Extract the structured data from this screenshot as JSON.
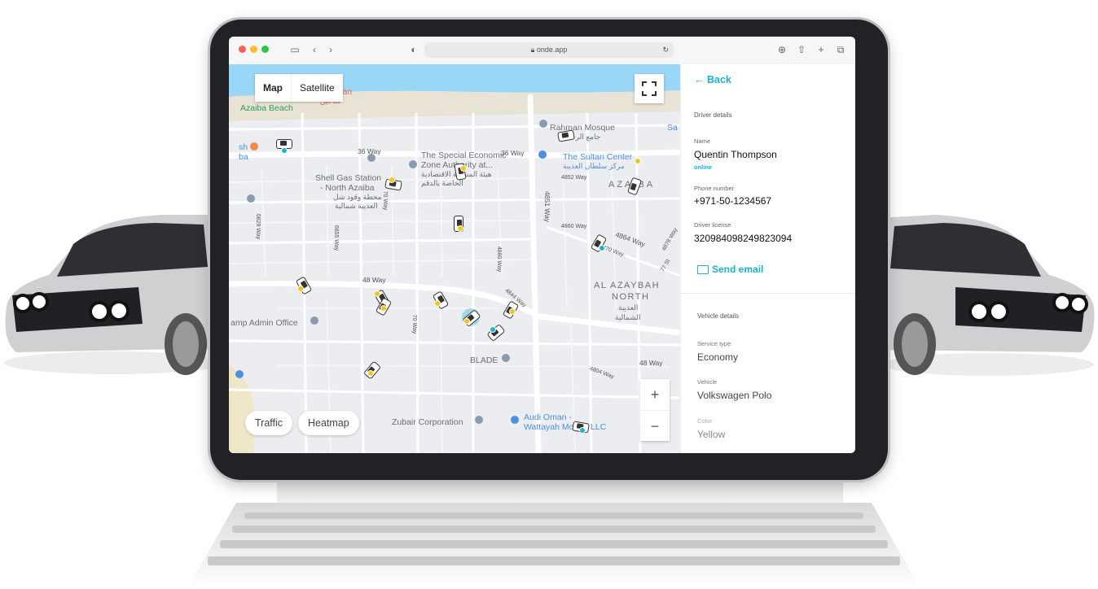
{
  "browser": {
    "url": "onde.app"
  },
  "map": {
    "map_tab": "Map",
    "satellite_tab": "Satellite",
    "traffic_button": "Traffic",
    "heatmap_button": "Heatmap",
    "zoom_in": "+",
    "zoom_out": "−",
    "labels": {
      "majeen": "najeen Oman",
      "majeen_ar": "ڤناخين",
      "azaiba_beach": "Azaiba Beach",
      "way36_a": "36 Way",
      "way36_b": "36 Way",
      "rahman": "Rahman Mosque",
      "rahman_ar": "جامع الرحمن",
      "sa": "Sa",
      "sh": "sh",
      "ba": "ba",
      "special1": "The Special Economic",
      "special2": "Zone Authority at...",
      "special_ar1": "هيئة المنطقة الاقتصادية",
      "special_ar2": "الخاصة بالدقم",
      "sultan": "The Sultan Center",
      "sultan_ar": "مركز سلطان العذيبة",
      "shell1": "Shell Gas Station",
      "shell2": "- North Azaiba",
      "shell_ar1": "محطة وقود شل",
      "shell_ar2": "العذيبة شمالية",
      "azaiba": "AZAIBA",
      "al_azaybah1": "AL AZAYBAH",
      "al_azaybah2": "NORTH",
      "al_azaybah_ar1": "العذيبة",
      "al_azaybah_ar2": "الشمالية",
      "way48_a": "48 Way",
      "way48_b": "48 Way",
      "camp": "amp Admin Office",
      "blade": "BLADE",
      "zubair": "Zubair Corporation",
      "audi1": "Audi Oman -",
      "audi2": "Wattayah Motors LLC",
      "w4852": "4852 Way",
      "w4851": "4851 Way",
      "w4860": "4860 Way",
      "w4864": "4864 Way",
      "w4870": "4870 Way",
      "w4878": "4878 Way",
      "w77st": "77 St",
      "w6829": "6829 Way",
      "w6855": "6855 Way",
      "w70a": "70 Way",
      "w70b": "70 Way",
      "w4844": "4844 Way",
      "w4804": "4804 Way",
      "w4880": "4880 Way"
    }
  },
  "panel": {
    "back_label": "Back",
    "driver_section": "Driver details",
    "name_label": "Name",
    "name_value": "Quentin Thompson",
    "status": "online",
    "phone_label": "Phone number",
    "phone_value": "+971-50-1234567",
    "license_label": "Driver license",
    "license_value": "320984098249823094",
    "send_email": "Send email",
    "vehicle_section": "Vehicle details",
    "service_label": "Service type",
    "service_value": "Economy",
    "vehicle_label": "Vehicle",
    "vehicle_value": "Volkswagen Polo",
    "color_label": "Color",
    "color_value": "Yellow"
  },
  "colors": {
    "accent": "#1bb3c7",
    "water": "#9ad6f5",
    "taxi_yellow": "#f5c518",
    "taxi_teal": "#1bb3c7",
    "poi_blue": "#4b8fe0"
  }
}
